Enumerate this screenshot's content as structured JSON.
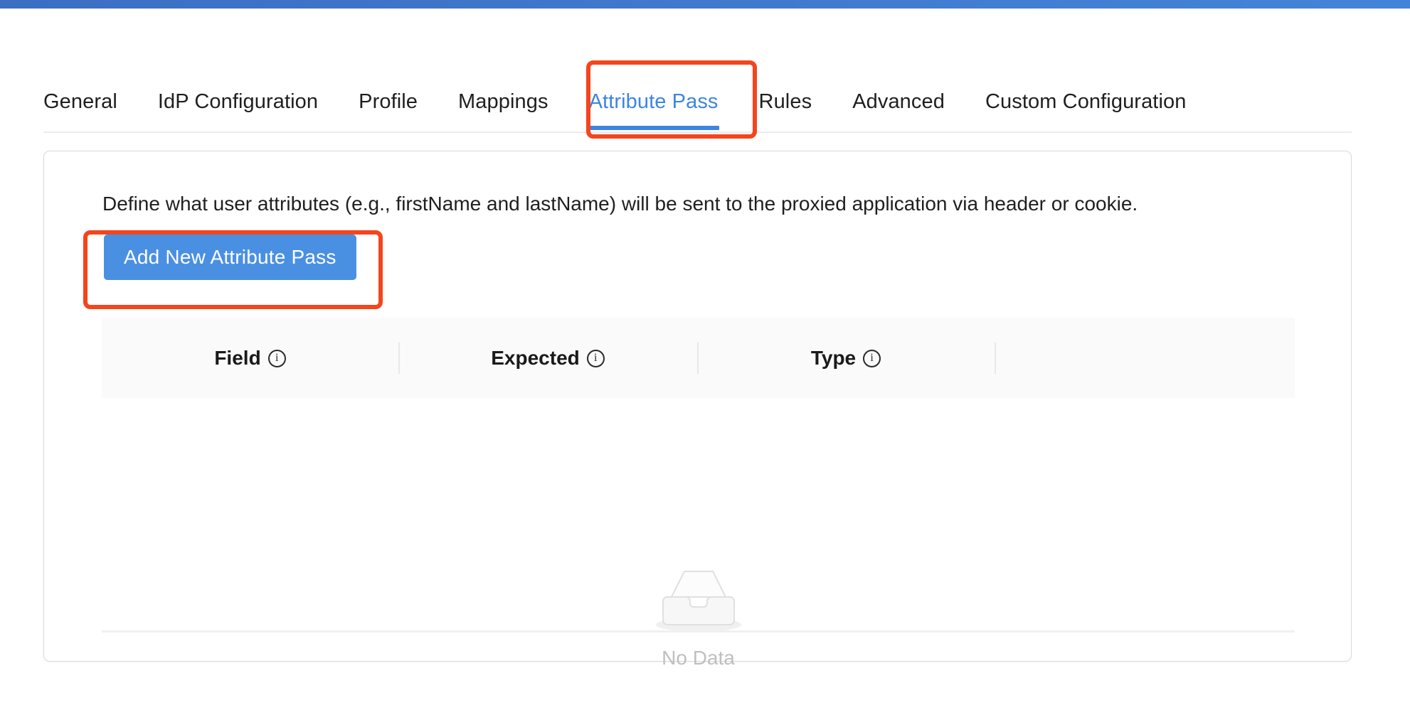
{
  "window": {
    "accent_blue": "#3d85e0",
    "topbar_color": "#3f77cc",
    "annotation_color": "#f4451d",
    "button_color": "#4a90e2"
  },
  "tabs": {
    "items": [
      {
        "label": "General",
        "active": false
      },
      {
        "label": "IdP Configuration",
        "active": false
      },
      {
        "label": "Profile",
        "active": false
      },
      {
        "label": "Mappings",
        "active": false
      },
      {
        "label": "Attribute Pass",
        "active": true
      },
      {
        "label": "Rules",
        "active": false
      },
      {
        "label": "Advanced",
        "active": false
      },
      {
        "label": "Custom Configuration",
        "active": false
      }
    ]
  },
  "panel": {
    "description": "Define what user attributes (e.g., firstName and lastName) will be sent to the proxied application via header or cookie.",
    "add_button_label": "Add New Attribute Pass"
  },
  "table": {
    "columns": [
      {
        "label": "Field",
        "info": "info-icon"
      },
      {
        "label": "Expected",
        "info": "info-icon"
      },
      {
        "label": "Type",
        "info": "info-icon"
      },
      {
        "label": "",
        "info": ""
      }
    ],
    "rows": [],
    "empty_state": {
      "icon": "empty-inbox-icon",
      "label": "No Data"
    }
  },
  "annotations": {
    "tab_highlight": "Attribute Pass",
    "button_highlight": "Add New Attribute Pass"
  }
}
